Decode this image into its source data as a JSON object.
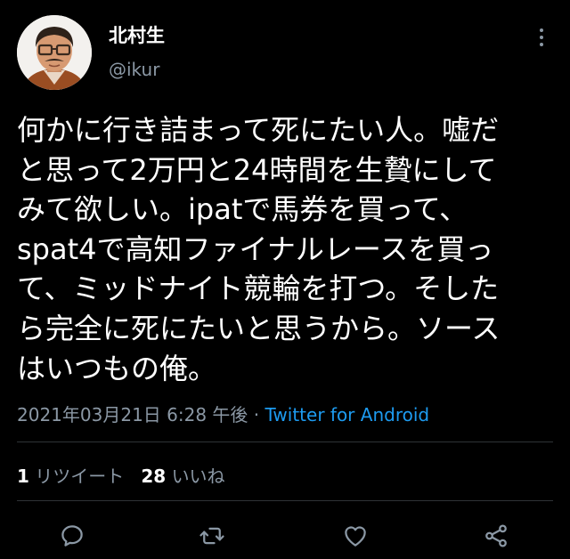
{
  "author": {
    "display_name": "北村生",
    "handle": "@ikur"
  },
  "tweet": {
    "lines": [
      "何かに行き詰まって死にたい人。嘘だ",
      "と思って2万円と24時間を生贄にして",
      "みて欲しい。ipatで馬券を買って、",
      "spat4で高知ファイナルレースを買っ",
      "て、ミッドナイト競輪を打つ。そした",
      "ら完全に死にたいと思うから。ソース",
      "はいつもの俺。"
    ],
    "timestamp": "2021年03月21日 6:28 午後",
    "separator": " · ",
    "source": "Twitter for Android"
  },
  "stats": {
    "retweets_count": "1",
    "retweets_label": "リツイート",
    "likes_count": "28",
    "likes_label": "いいね"
  },
  "icons": {
    "more": "more-vertical-icon",
    "reply": "reply-icon",
    "retweet": "retweet-icon",
    "like": "heart-icon",
    "share": "share-icon"
  },
  "colors": {
    "background": "#000000",
    "text": "#ffffff",
    "secondary": "#8b98a5",
    "link": "#1d9bf0",
    "divider": "#2f3336"
  }
}
